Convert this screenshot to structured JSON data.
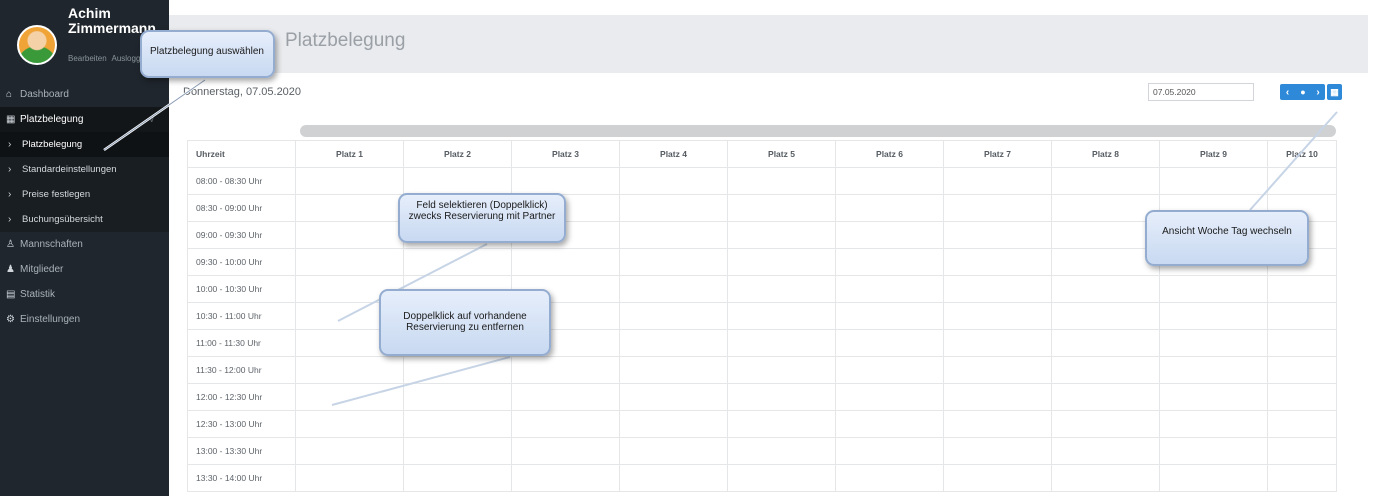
{
  "user": {
    "name": "Achim Zimmermann",
    "edit_link": "Bearbeiten",
    "logout_link": "Ausloggen"
  },
  "sidebar": {
    "items": [
      {
        "label": "Dashboard",
        "icon": "home-icon"
      },
      {
        "label": "Platzbelegung",
        "icon": "calendar-icon"
      },
      {
        "label": "Platzbelegung"
      },
      {
        "label": "Standardeinstellungen"
      },
      {
        "label": "Preise festlegen"
      },
      {
        "label": "Buchungsübersicht"
      },
      {
        "label": "Mannschaften",
        "icon": "group-icon"
      },
      {
        "label": "Mitglieder",
        "icon": "user-icon"
      },
      {
        "label": "Statistik",
        "icon": "chart-icon"
      },
      {
        "label": "Einstellungen",
        "icon": "gear-icon"
      }
    ]
  },
  "page": {
    "title": "Platzbelegung",
    "date_heading": "Donnerstag, 07.05.2020",
    "date_input": "07.05.2020"
  },
  "table": {
    "headers": [
      "Uhrzeit",
      "Platz 1",
      "Platz 2",
      "Platz 3",
      "Platz 4",
      "Platz 5",
      "Platz 6",
      "Platz 7",
      "Platz 8",
      "Platz 9",
      "Platz 10"
    ],
    "times": [
      "08:00 - 08:30 Uhr",
      "08:30 - 09:00 Uhr",
      "09:00 - 09:30 Uhr",
      "09:30 - 10:00 Uhr",
      "10:00 - 10:30 Uhr",
      "10:30 - 11:00 Uhr",
      "11:00 - 11:30 Uhr",
      "11:30 - 12:00 Uhr",
      "12:00 - 12:30 Uhr",
      "12:30 - 13:00 Uhr",
      "13:00 - 13:30 Uhr",
      "13:30 - 14:00 Uhr"
    ]
  },
  "callouts": {
    "select_field": "Platzbelegung auswählen",
    "double_click_select": "Feld selektieren (Doppelklick) zwecks Reservierung mit Partner",
    "double_click_remove": "Doppelklick auf vorhandene Reservierung zu entfernen",
    "switch_view": "Ansicht Woche Tag wechseln"
  },
  "colors": {
    "sidebar_bg": "#1f262d",
    "accent": "#2e8ad8",
    "callout_bg": "#d6e3f6"
  }
}
